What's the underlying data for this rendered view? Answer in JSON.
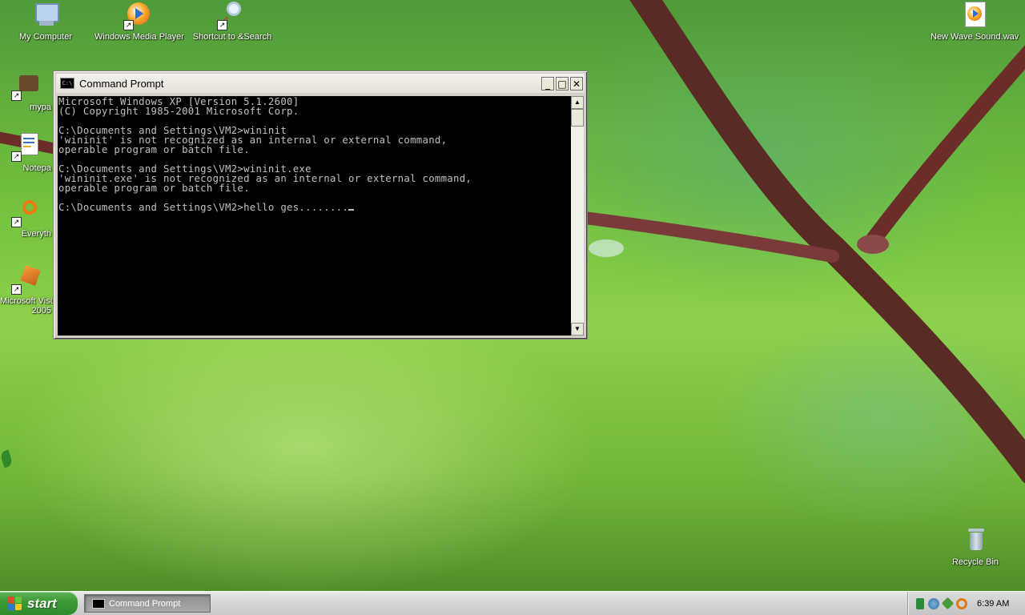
{
  "desktop": {
    "icons": [
      {
        "label": "My Computer",
        "icon": "my-computer-icon"
      },
      {
        "label": "Windows Media Player",
        "icon": "media-player-icon"
      },
      {
        "label": "Shortcut to &Search",
        "icon": "search-icon"
      },
      {
        "label": "New Wave Sound.wav",
        "icon": "wave-sound-icon"
      },
      {
        "label": "mypa",
        "icon": "folder-shortcut-icon"
      },
      {
        "label": "Notepa",
        "icon": "notepad-icon"
      },
      {
        "label": "Everyth",
        "icon": "everything-icon"
      },
      {
        "label": "Microsoft Visu",
        "label_line2": "2005",
        "icon": "visual-studio-icon"
      },
      {
        "label": "Recycle Bin",
        "icon": "recycle-bin-icon"
      }
    ]
  },
  "window": {
    "title": "Command Prompt",
    "minimize_glyph": "_",
    "maximize_glyph": "□",
    "close_glyph": "✕",
    "icon_glyph": "C:\\",
    "console_text": "Microsoft Windows XP [Version 5.1.2600]\n(C) Copyright 1985-2001 Microsoft Corp.\n\nC:\\Documents and Settings\\VM2>wininit\n'wininit' is not recognized as an internal or external command,\noperable program or batch file.\n\nC:\\Documents and Settings\\VM2>wininit.exe\n'wininit.exe' is not recognized as an internal or external command,\noperable program or batch file.\n\nC:\\Documents and Settings\\VM2>hello ges........",
    "scroll_up_glyph": "▲",
    "scroll_down_glyph": "▼"
  },
  "taskbar": {
    "start_label": "start",
    "tasks": [
      {
        "label": "Command Prompt",
        "icon": "cmd-icon"
      }
    ],
    "tray_icons": [
      "network-icon",
      "volume-icon",
      "security-icon",
      "search-tray-icon"
    ],
    "clock": "6:39 AM"
  },
  "colors": {
    "console_bg": "#000000",
    "console_fg": "#c0c0c0",
    "start_green": "#3c9b36",
    "wallpaper_green": "#74c23e"
  }
}
